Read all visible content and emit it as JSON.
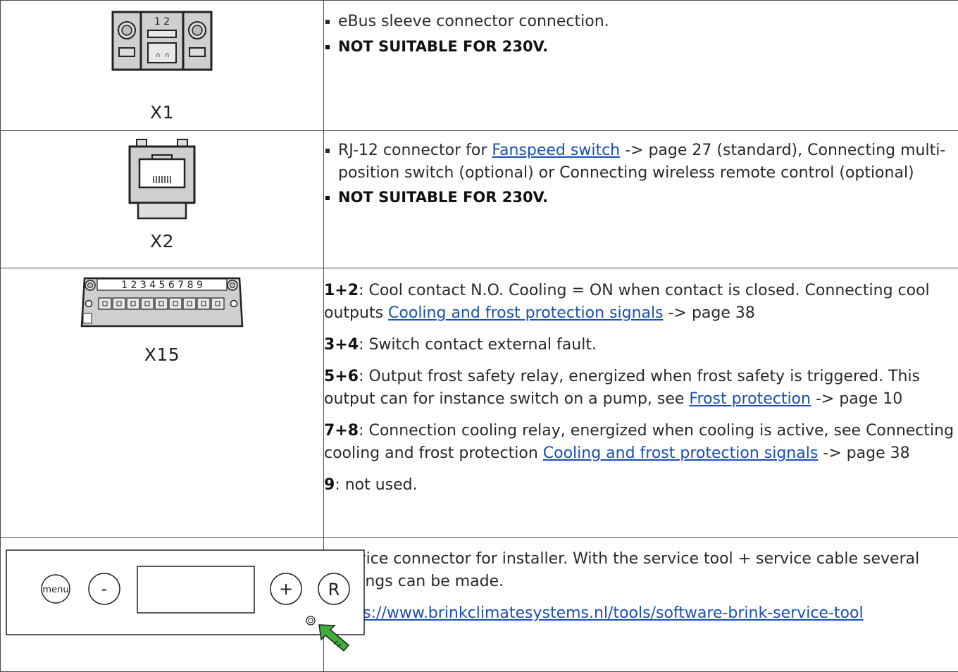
{
  "rows": [
    {
      "label": "X1",
      "bullets": [
        "eBus sleeve connector connection."
      ],
      "warning": "NOT SUITABLE FOR 230V."
    },
    {
      "label": "X2",
      "bullet_pre": "RJ-12 connector for ",
      "bullet_link": "Fanspeed switch",
      "bullet_post": " -> page 27 (standard), Connecting multi-position switch (optional) or Connecting wireless remote control (optional)",
      "warning": "NOT SUITABLE FOR 230V."
    },
    {
      "label": "X15",
      "pin_numbers": "1 2 3 4 5 6 7 8 9",
      "items": [
        {
          "pins": "1+2",
          "pre": ": Cool contact N.O. Cooling = ON when contact is closed. Connecting cool outputs ",
          "link": "Cooling and frost protection signals",
          "post": " -> page 38"
        },
        {
          "pins": "3+4",
          "pre": ": Switch contact external fault.",
          "link": "",
          "post": ""
        },
        {
          "pins": "5+6",
          "pre": ": Output frost safety relay, energized when frost safety is triggered. This output can for instance switch on a pump, see ",
          "link": "Frost protection",
          "post": " -> page 10"
        },
        {
          "pins": "7+8",
          "pre": ": Connection cooling relay, energized when cooling is active, see Connecting cooling and frost protection ",
          "link": "Cooling and frost protection signals",
          "post": " -> page 38"
        },
        {
          "pins": "9",
          "pre": ": not used.",
          "link": "",
          "post": ""
        }
      ]
    },
    {
      "panel": {
        "menu_label": "menu",
        "minus_label": "-",
        "plus_label": "+",
        "reset_label": "R"
      },
      "description": "Service connector for installer. With the service tool + service cable several settings can be made.",
      "url": "https://www.brinkclimatesystems.nl/tools/software-brink-service-tool"
    }
  ],
  "x1_pins": "1 2",
  "colors": {
    "link": "#1a4fb5",
    "arrow": "#3cae3c",
    "border": "#4a4a4a"
  }
}
